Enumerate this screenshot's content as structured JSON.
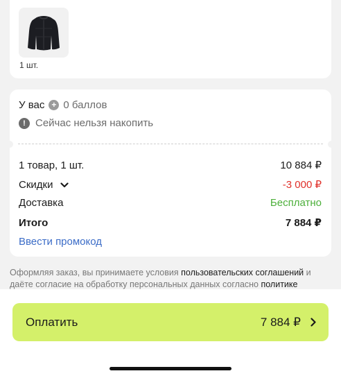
{
  "item": {
    "quantity": "1 шт.",
    "image": "black-jacket"
  },
  "points": {
    "prefix": "У вас",
    "value": "0 баллов",
    "icon": "plus-circle-icon",
    "notice": "Сейчас нельзя накопить",
    "notice_icon": "info-icon"
  },
  "summary": {
    "items_label": "1 товар, 1 шт.",
    "items_value": "10 884 ₽",
    "discount_label": "Скидки",
    "discount_value": "-3 000 ₽",
    "delivery_label": "Доставка",
    "delivery_value": "Бесплатно",
    "total_label": "Итого",
    "total_value": "7 884 ₽"
  },
  "promo": {
    "label": "Ввести промокод"
  },
  "legal": {
    "part1": "Оформляя заказ, вы принимаете условия ",
    "link1": "пользовательских соглашений",
    "part2": " и даёте согласие на обработку персональных данных согласно ",
    "link2": "политике"
  },
  "pay": {
    "label": "Оплатить",
    "amount": "7 884 ₽"
  },
  "colors": {
    "accent": "#d4f06a",
    "discount": "#e0302a",
    "free": "#4caf3a",
    "link": "#3b6cc7"
  }
}
